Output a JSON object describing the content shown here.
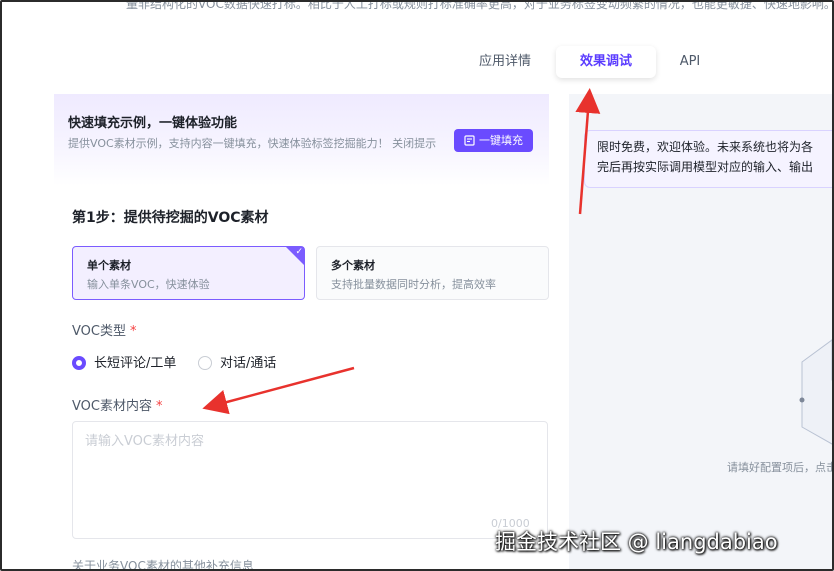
{
  "header": {
    "top_text": "量非结构化的VOC数据快速打标。相比于人工打标或规则打标准确率更高，对于业务标签变动频繁的情况，也能更敏捷、快速地影响。"
  },
  "tabs": [
    {
      "label": "应用详情",
      "active": false
    },
    {
      "label": "效果调试",
      "active": true
    },
    {
      "label": "API",
      "active": false
    }
  ],
  "banner": {
    "title": "快速填充示例，一键体验功能",
    "description": "提供VOC素材示例，支持内容一键填充，快速体验标签挖掘能力！ 关闭提示",
    "fill_button": "一键填充"
  },
  "step1": {
    "title": "第1步：提供待挖掘的VOC素材",
    "options": [
      {
        "title": "单个素材",
        "desc": "输入单条VOC，快速体验",
        "selected": true
      },
      {
        "title": "多个素材",
        "desc": "支持批量数据同时分析，提高效率",
        "selected": false
      }
    ],
    "voc_type_label": "VOC类型",
    "required_mark": "*",
    "radios": [
      {
        "label": "长短评论/工单",
        "checked": true
      },
      {
        "label": "对话/通话",
        "checked": false
      }
    ],
    "content_label": "VOC素材内容",
    "content_placeholder": "请输入VOC素材内容",
    "counter": "0/1000",
    "bottom_text": "关于业务VOC素材的其他补充信息"
  },
  "right": {
    "notice_line1": "限时免费，欢迎体验。未来系统也将为各",
    "notice_line2": "完后再按实际调用模型对应的输入、输出",
    "hint": "请填好配置项后，点击"
  },
  "watermark": "掘金技术社区 @ liangdabiao",
  "colors": {
    "accent": "#6a4bff",
    "arrow": "#e8322d",
    "required": "#f53f3f"
  }
}
